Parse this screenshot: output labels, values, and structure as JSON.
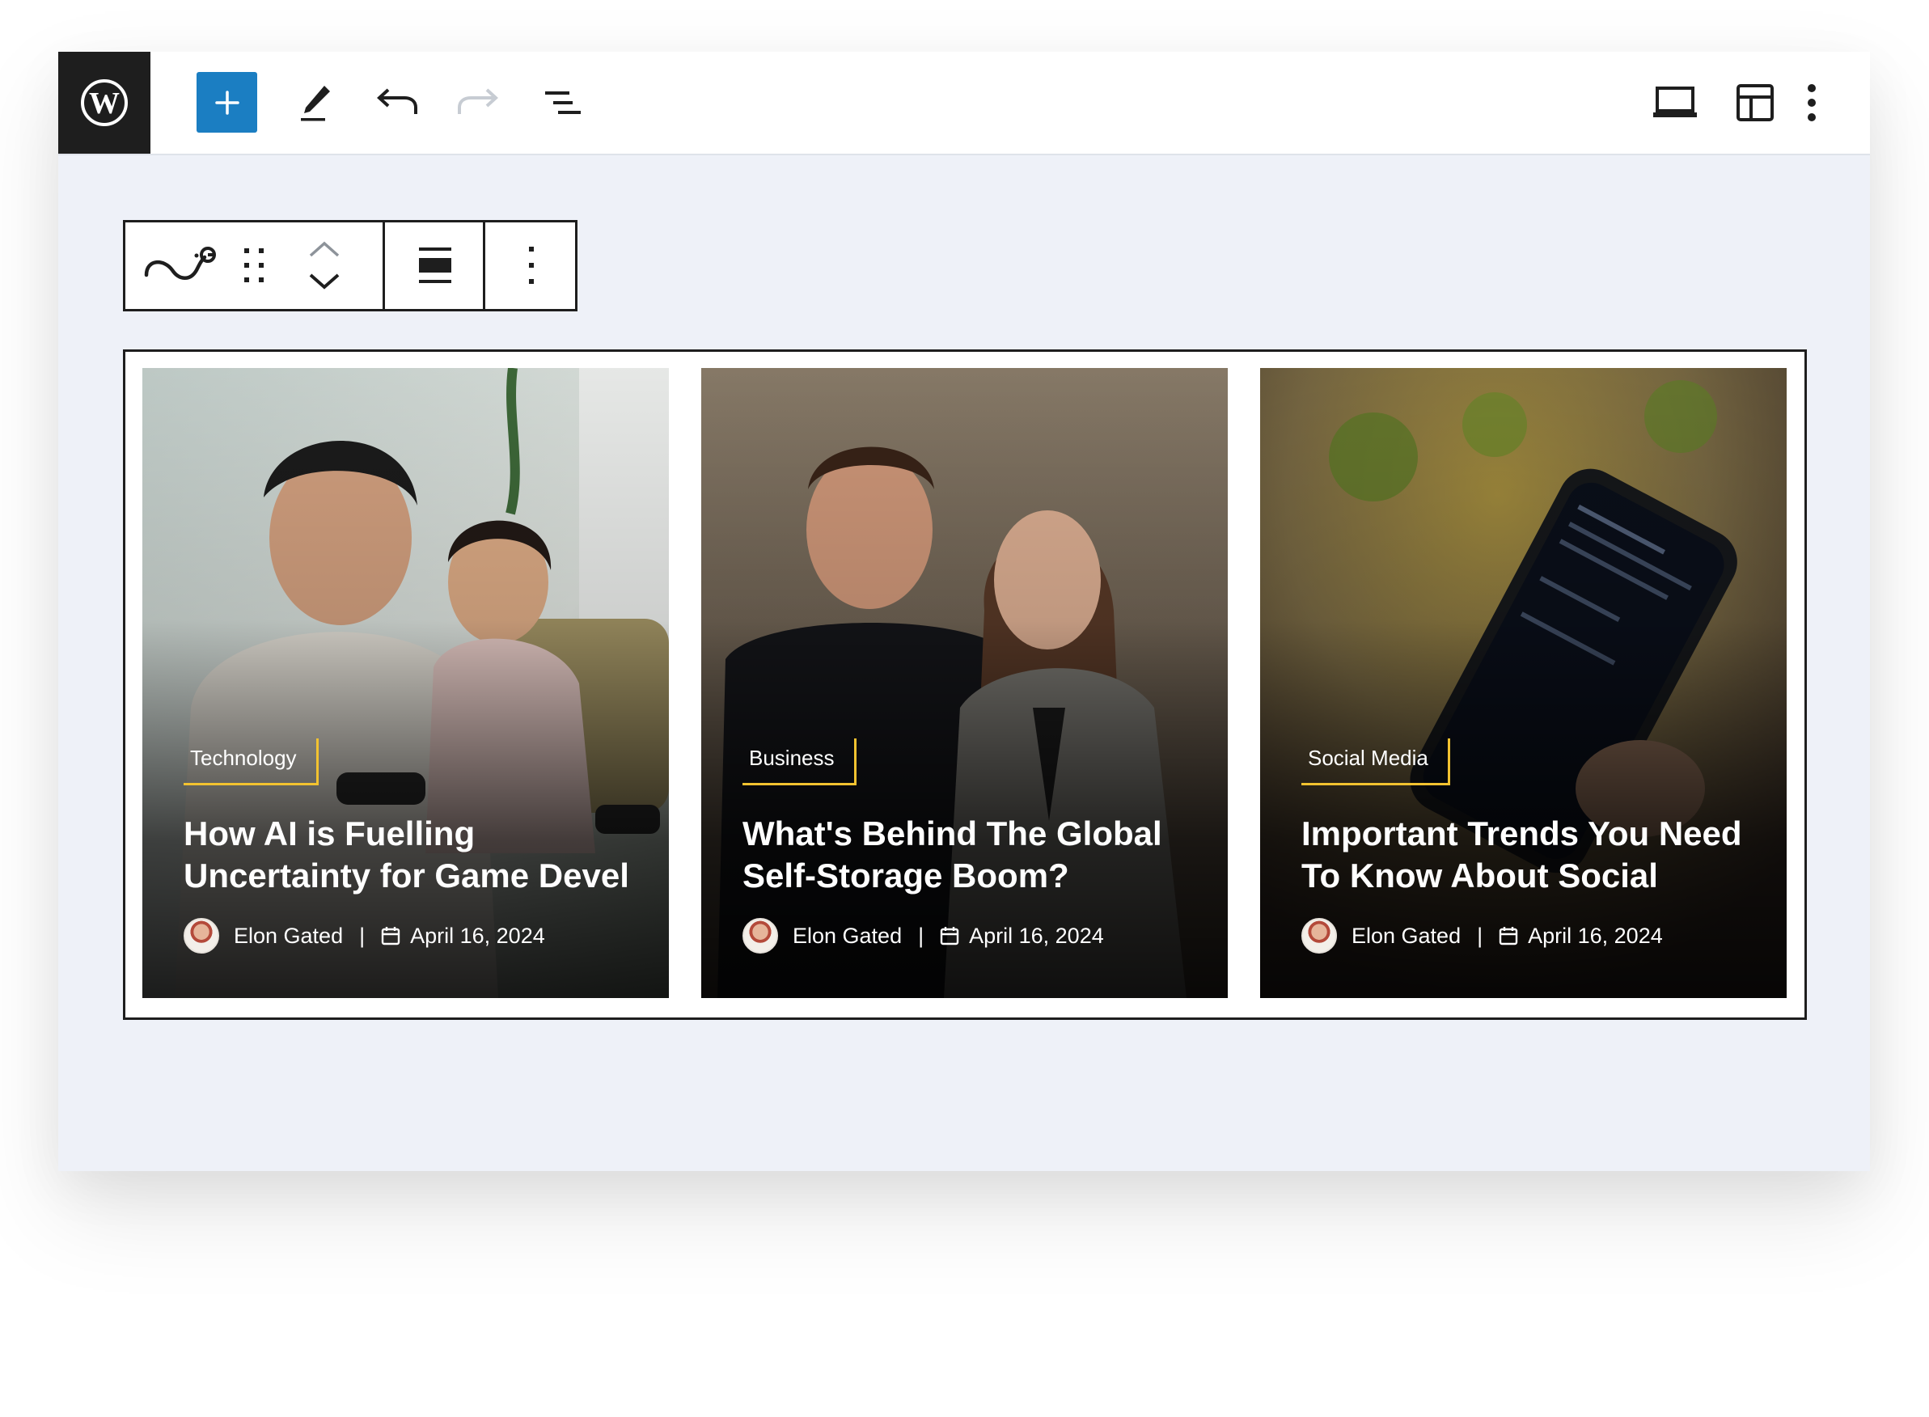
{
  "toolbar": {
    "logo_icon": "wordpress-logo-icon",
    "accent_color": "#1b7ec2",
    "items": [
      {
        "name": "add-block-button",
        "icon": "plus-icon"
      },
      {
        "name": "tools-button",
        "icon": "pencil-icon"
      },
      {
        "name": "undo-button",
        "icon": "undo-icon"
      },
      {
        "name": "redo-button",
        "icon": "redo-icon"
      },
      {
        "name": "document-overview-button",
        "icon": "list-view-icon"
      },
      {
        "name": "preview-button",
        "icon": "laptop-icon"
      },
      {
        "name": "settings-button",
        "icon": "sidebar-layout-icon"
      },
      {
        "name": "options-button",
        "icon": "vertical-dots-icon"
      }
    ]
  },
  "block_toolbar": {
    "items": [
      {
        "name": "block-type-button",
        "icon": "block-plugin-icon"
      },
      {
        "name": "drag-handle",
        "icon": "drag-dots-icon"
      },
      {
        "name": "move-up-button",
        "icon": "chevron-up-icon"
      },
      {
        "name": "move-down-button",
        "icon": "chevron-down-icon"
      },
      {
        "name": "align-button",
        "icon": "align-wide-icon"
      },
      {
        "name": "block-options-button",
        "icon": "vertical-dots-icon"
      }
    ]
  },
  "posts": [
    {
      "category": "Technology",
      "title": "How AI is Fuelling\nUncertainty for Game Devel",
      "author": "Elon Gated",
      "separator": "|",
      "date": "April 16, 2024"
    },
    {
      "category": "Business",
      "title": "What's Behind The Global\nSelf-Storage Boom?",
      "author": "Elon Gated",
      "separator": "|",
      "date": "April 16, 2024"
    },
    {
      "category": "Social Media",
      "title": "Important Trends You Need\nTo Know About Social",
      "author": "Elon Gated",
      "separator": "|",
      "date": "April 16, 2024"
    }
  ],
  "colors": {
    "category_underline": "#f2c230",
    "canvas_background": "#eef1f8",
    "block_border": "#1e1e1e"
  }
}
